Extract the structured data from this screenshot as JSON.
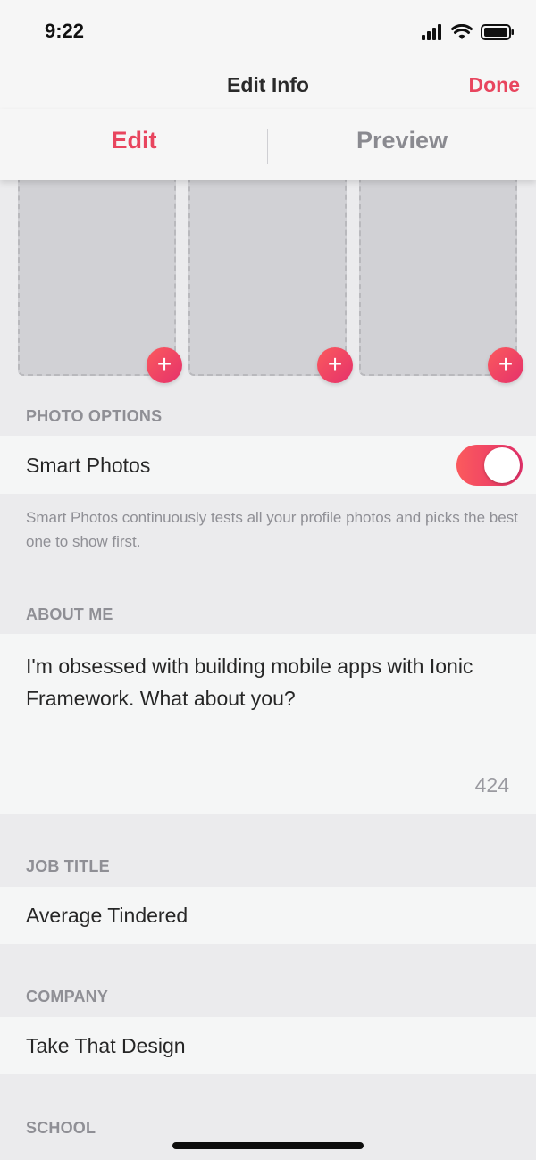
{
  "status": {
    "time": "9:22"
  },
  "header": {
    "title": "Edit Info",
    "done_label": "Done"
  },
  "tabs": [
    {
      "label": "Edit",
      "active": true
    },
    {
      "label": "Preview",
      "active": false
    }
  ],
  "photos": {
    "add_label": "+"
  },
  "photo_options": {
    "section_label": "PHOTO OPTIONS",
    "smart_photos_label": "Smart Photos",
    "smart_photos_enabled": true,
    "hint": "Smart Photos continuously tests all your profile photos and picks the best one to show first."
  },
  "about": {
    "section_label": "ABOUT ME",
    "text": "I'm obsessed with building mobile apps with Ionic Framework. What about you?",
    "remaining": "424"
  },
  "job": {
    "section_label": "JOB TITLE",
    "value": "Average Tindered"
  },
  "company": {
    "section_label": "COMPANY",
    "value": "Take That Design"
  },
  "school": {
    "section_label": "SCHOOL"
  },
  "colors": {
    "accent": "#e8455e",
    "gradient_start": "#fb5a5d",
    "gradient_end": "#e5316b"
  }
}
